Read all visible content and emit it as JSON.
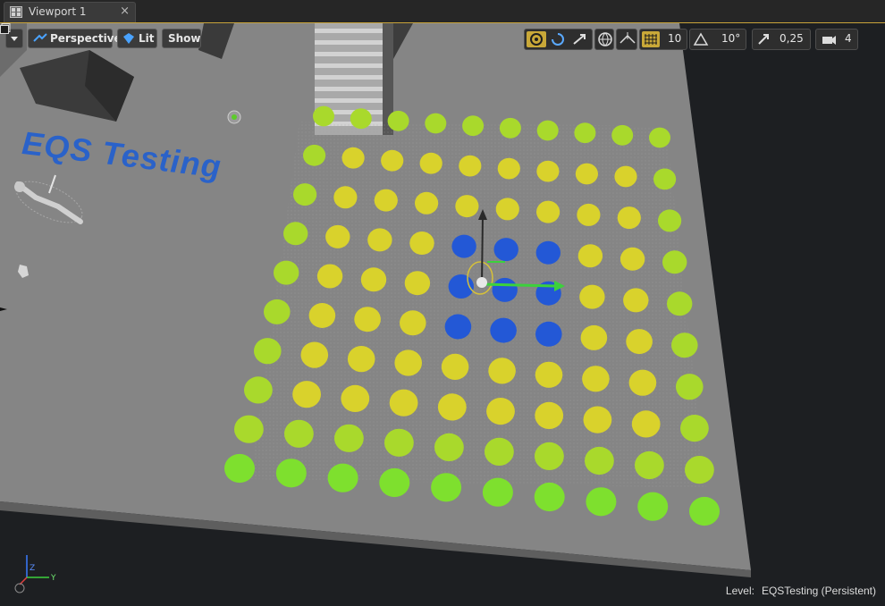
{
  "tab": {
    "title": "Viewport 1",
    "close": "×"
  },
  "toolbar": {
    "menu_icon": "dropdown-arrow-icon",
    "perspective_label": "Perspective",
    "lit_label": "Lit",
    "show_label": "Show",
    "grid_snap_value": "10",
    "rotate_snap_value": "10°",
    "scale_snap_value": "0,25",
    "camera_speed_value": "4"
  },
  "scene": {
    "label_text": "EQS Testing",
    "grid_columns": 10,
    "grid_rows": 10,
    "colors": {
      "green": "#7ee02e",
      "yellow": "#d9d22c",
      "blue": "#2358d6",
      "floor": "#858585",
      "dark": "#1f1f1f",
      "accent": "#c9a838"
    }
  },
  "axes": {
    "x_label": "Z",
    "y_label": "Y"
  },
  "status": {
    "level_label": "Level:",
    "level_value": "EQSTesting (Persistent)"
  }
}
